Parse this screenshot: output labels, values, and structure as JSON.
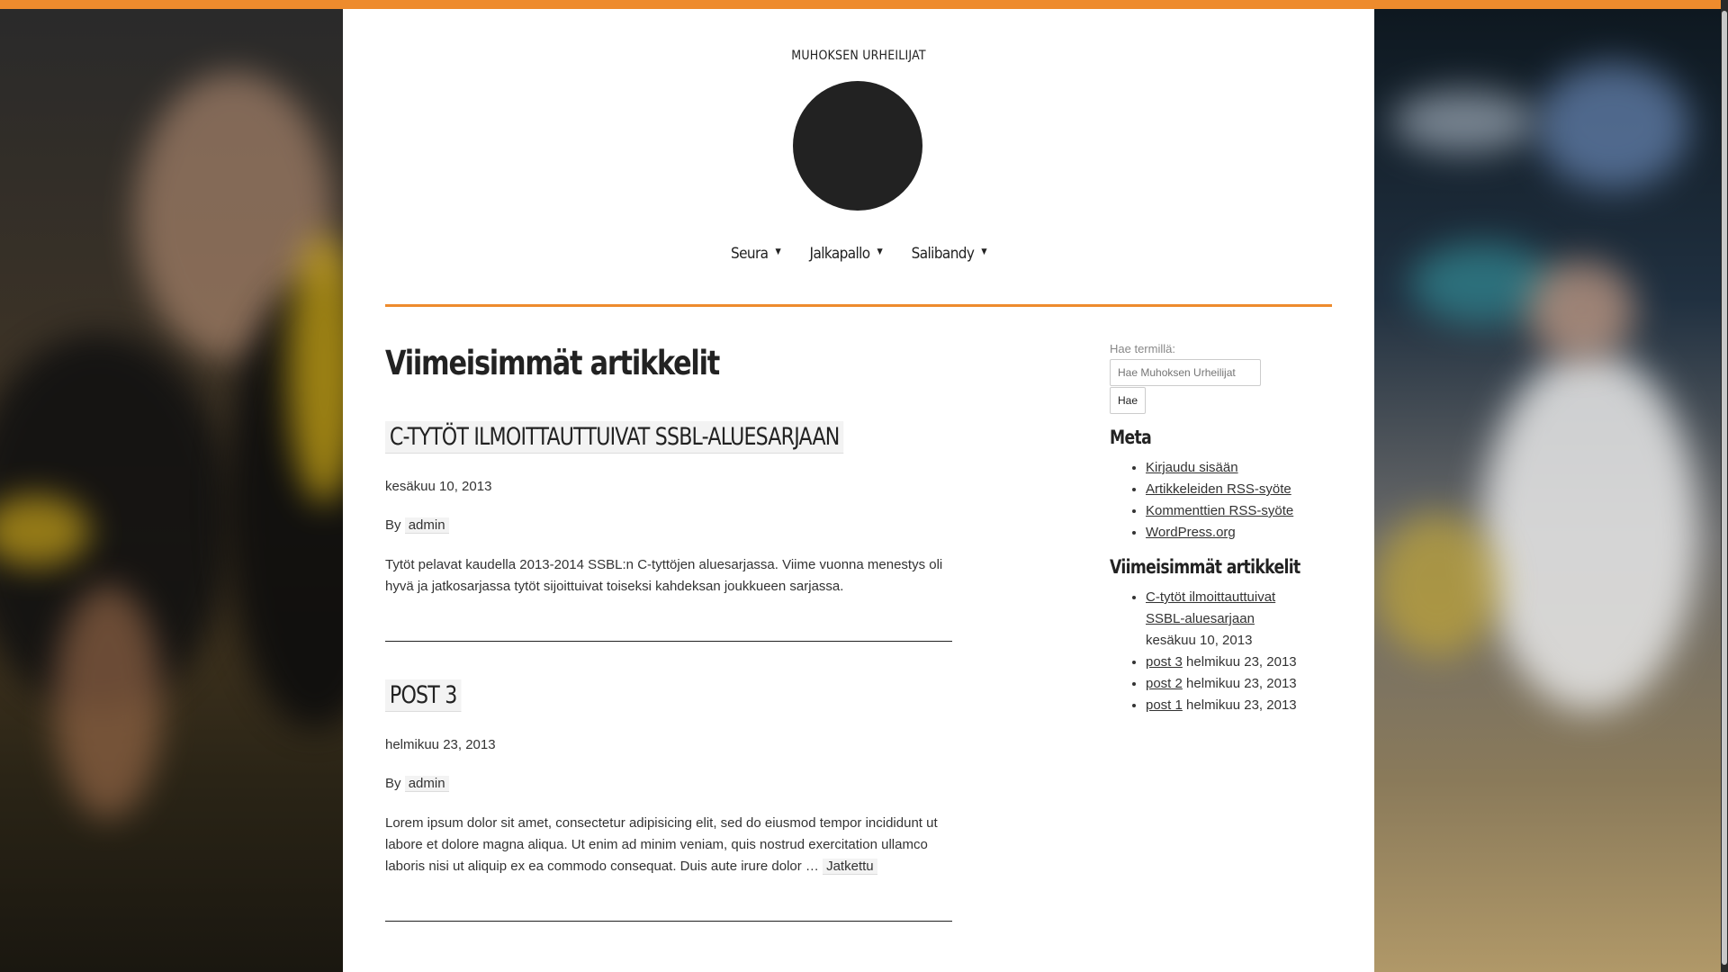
{
  "site": {
    "title": "MUHOKSEN URHEILIJAT"
  },
  "nav": {
    "items": [
      {
        "label": "Seura",
        "caret": "▼"
      },
      {
        "label": "Jalkapallo",
        "caret": "▼"
      },
      {
        "label": "Salibandy",
        "caret": "▼"
      }
    ]
  },
  "main": {
    "heading": "Viimeisimmät artikkelit",
    "posts": [
      {
        "title": "C-TYTÖT ILMOITTAUTTUIVAT SSBL-ALUESARJAAN",
        "date": "kesäkuu 10, 2013",
        "by": "By",
        "author": "admin",
        "excerpt": "Tytöt pelavat kaudella 2013-2014 SSBL:n C-tyttöjen aluesarjassa. Viime vuonna menestys oli hyvä ja jatkosarjassa tytöt sijoittuivat toiseksi kahdeksan joukkueen sarjassa."
      },
      {
        "title": "POST 3",
        "date": "helmikuu 23, 2013",
        "by": "By",
        "author": "admin",
        "excerpt": "Lorem ipsum dolor sit amet, consectetur adipisicing elit, sed do eiusmod tempor incididunt ut labore et dolore magna aliqua. Ut enim ad minim veniam, quis nostrud exercitation ullamco laboris nisi ut aliquip ex ea commodo consequat. Duis aute irure dolor …",
        "more": "Jatkettu"
      }
    ]
  },
  "sidebar": {
    "search": {
      "label": "Hae termillä:",
      "placeholder": "Hae Muhoksen Urheilijat",
      "button": "Hae"
    },
    "meta": {
      "title": "Meta",
      "links": [
        "Kirjaudu sisään",
        "Artikkeleiden RSS-syöte",
        "Kommenttien RSS-syöte",
        "WordPress.org"
      ]
    },
    "recent": {
      "title": "Viimeisimmät artikkelit",
      "items": [
        {
          "link": "C-tytöt ilmoittauttuivat SSBL-aluesarjaan",
          "date": "kesäkuu 10, 2013"
        },
        {
          "link": "post 3",
          "date": "helmikuu 23, 2013"
        },
        {
          "link": "post 2",
          "date": "helmikuu 23, 2013"
        },
        {
          "link": "post 1",
          "date": "helmikuu 23, 2013"
        }
      ]
    }
  },
  "colors": {
    "accent": "#ee8b2d",
    "text": "#222222",
    "logo": "#222222"
  }
}
